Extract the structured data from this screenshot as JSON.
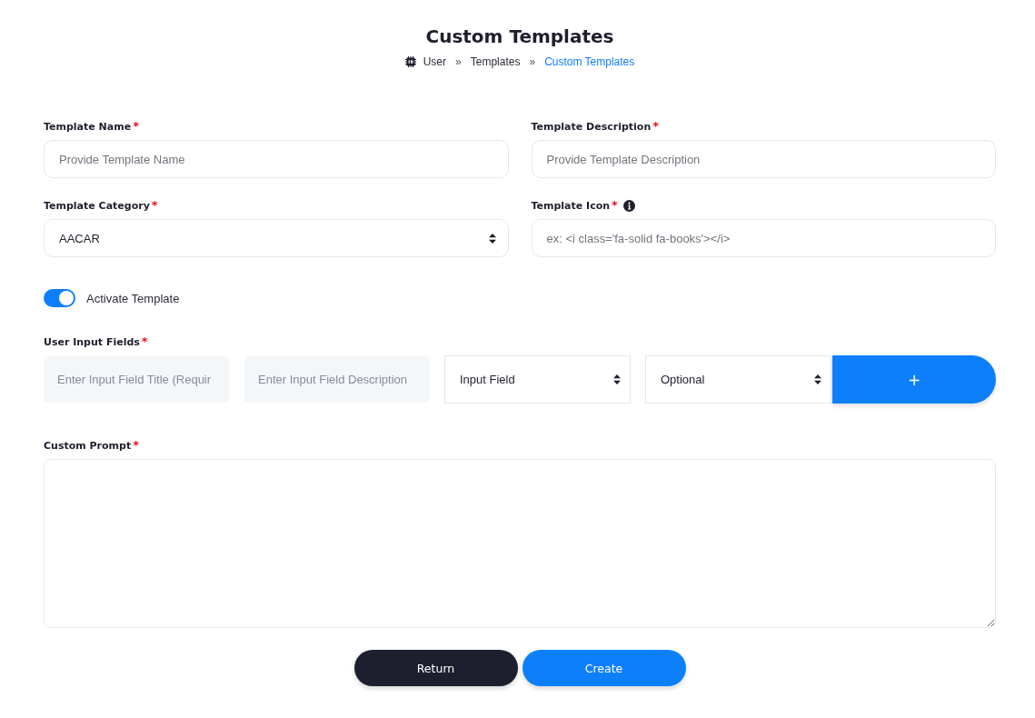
{
  "header": {
    "title": "Custom Templates",
    "breadcrumb": [
      {
        "kind": "crumb",
        "label": "User",
        "current": false
      },
      {
        "kind": "separator",
        "label": "»"
      },
      {
        "kind": "crumb",
        "label": "Templates",
        "current": false
      },
      {
        "kind": "separator",
        "label": "»"
      },
      {
        "kind": "crumb",
        "label": "Custom Templates",
        "current": true
      }
    ]
  },
  "fields": [
    {
      "kind": "text",
      "label": "Template Name",
      "required_mark": "*",
      "info": false,
      "placeholder": "Provide Template Name"
    },
    {
      "kind": "text",
      "label": "Template Description",
      "required_mark": "*",
      "info": false,
      "placeholder": "Provide Template Description"
    },
    {
      "kind": "select",
      "label": "Template Category",
      "required_mark": "*",
      "info": false,
      "value": "AACAR"
    },
    {
      "kind": "text",
      "label": "Template Icon",
      "required_mark": "*",
      "info": true,
      "placeholder": "ex: <i class='fa-solid fa-books'></i>"
    }
  ],
  "toggle": {
    "label": "Activate Template",
    "on": true
  },
  "user_input_fields": {
    "label": "User Input Fields",
    "required_mark": "*",
    "controls": [
      {
        "kind": "input",
        "placeholder": "Enter Input Field Title (Requir"
      },
      {
        "kind": "input",
        "placeholder": "Enter Input Field Description"
      },
      {
        "kind": "select",
        "value": "Input Field"
      },
      {
        "kind": "select",
        "value": "Optional"
      },
      {
        "kind": "button",
        "label": "+"
      }
    ]
  },
  "custom_prompt": {
    "label": "Custom Prompt",
    "required_mark": "*"
  },
  "actions": [
    {
      "kind": "secondary",
      "label": "Return"
    },
    {
      "kind": "primary",
      "label": "Create"
    }
  ]
}
